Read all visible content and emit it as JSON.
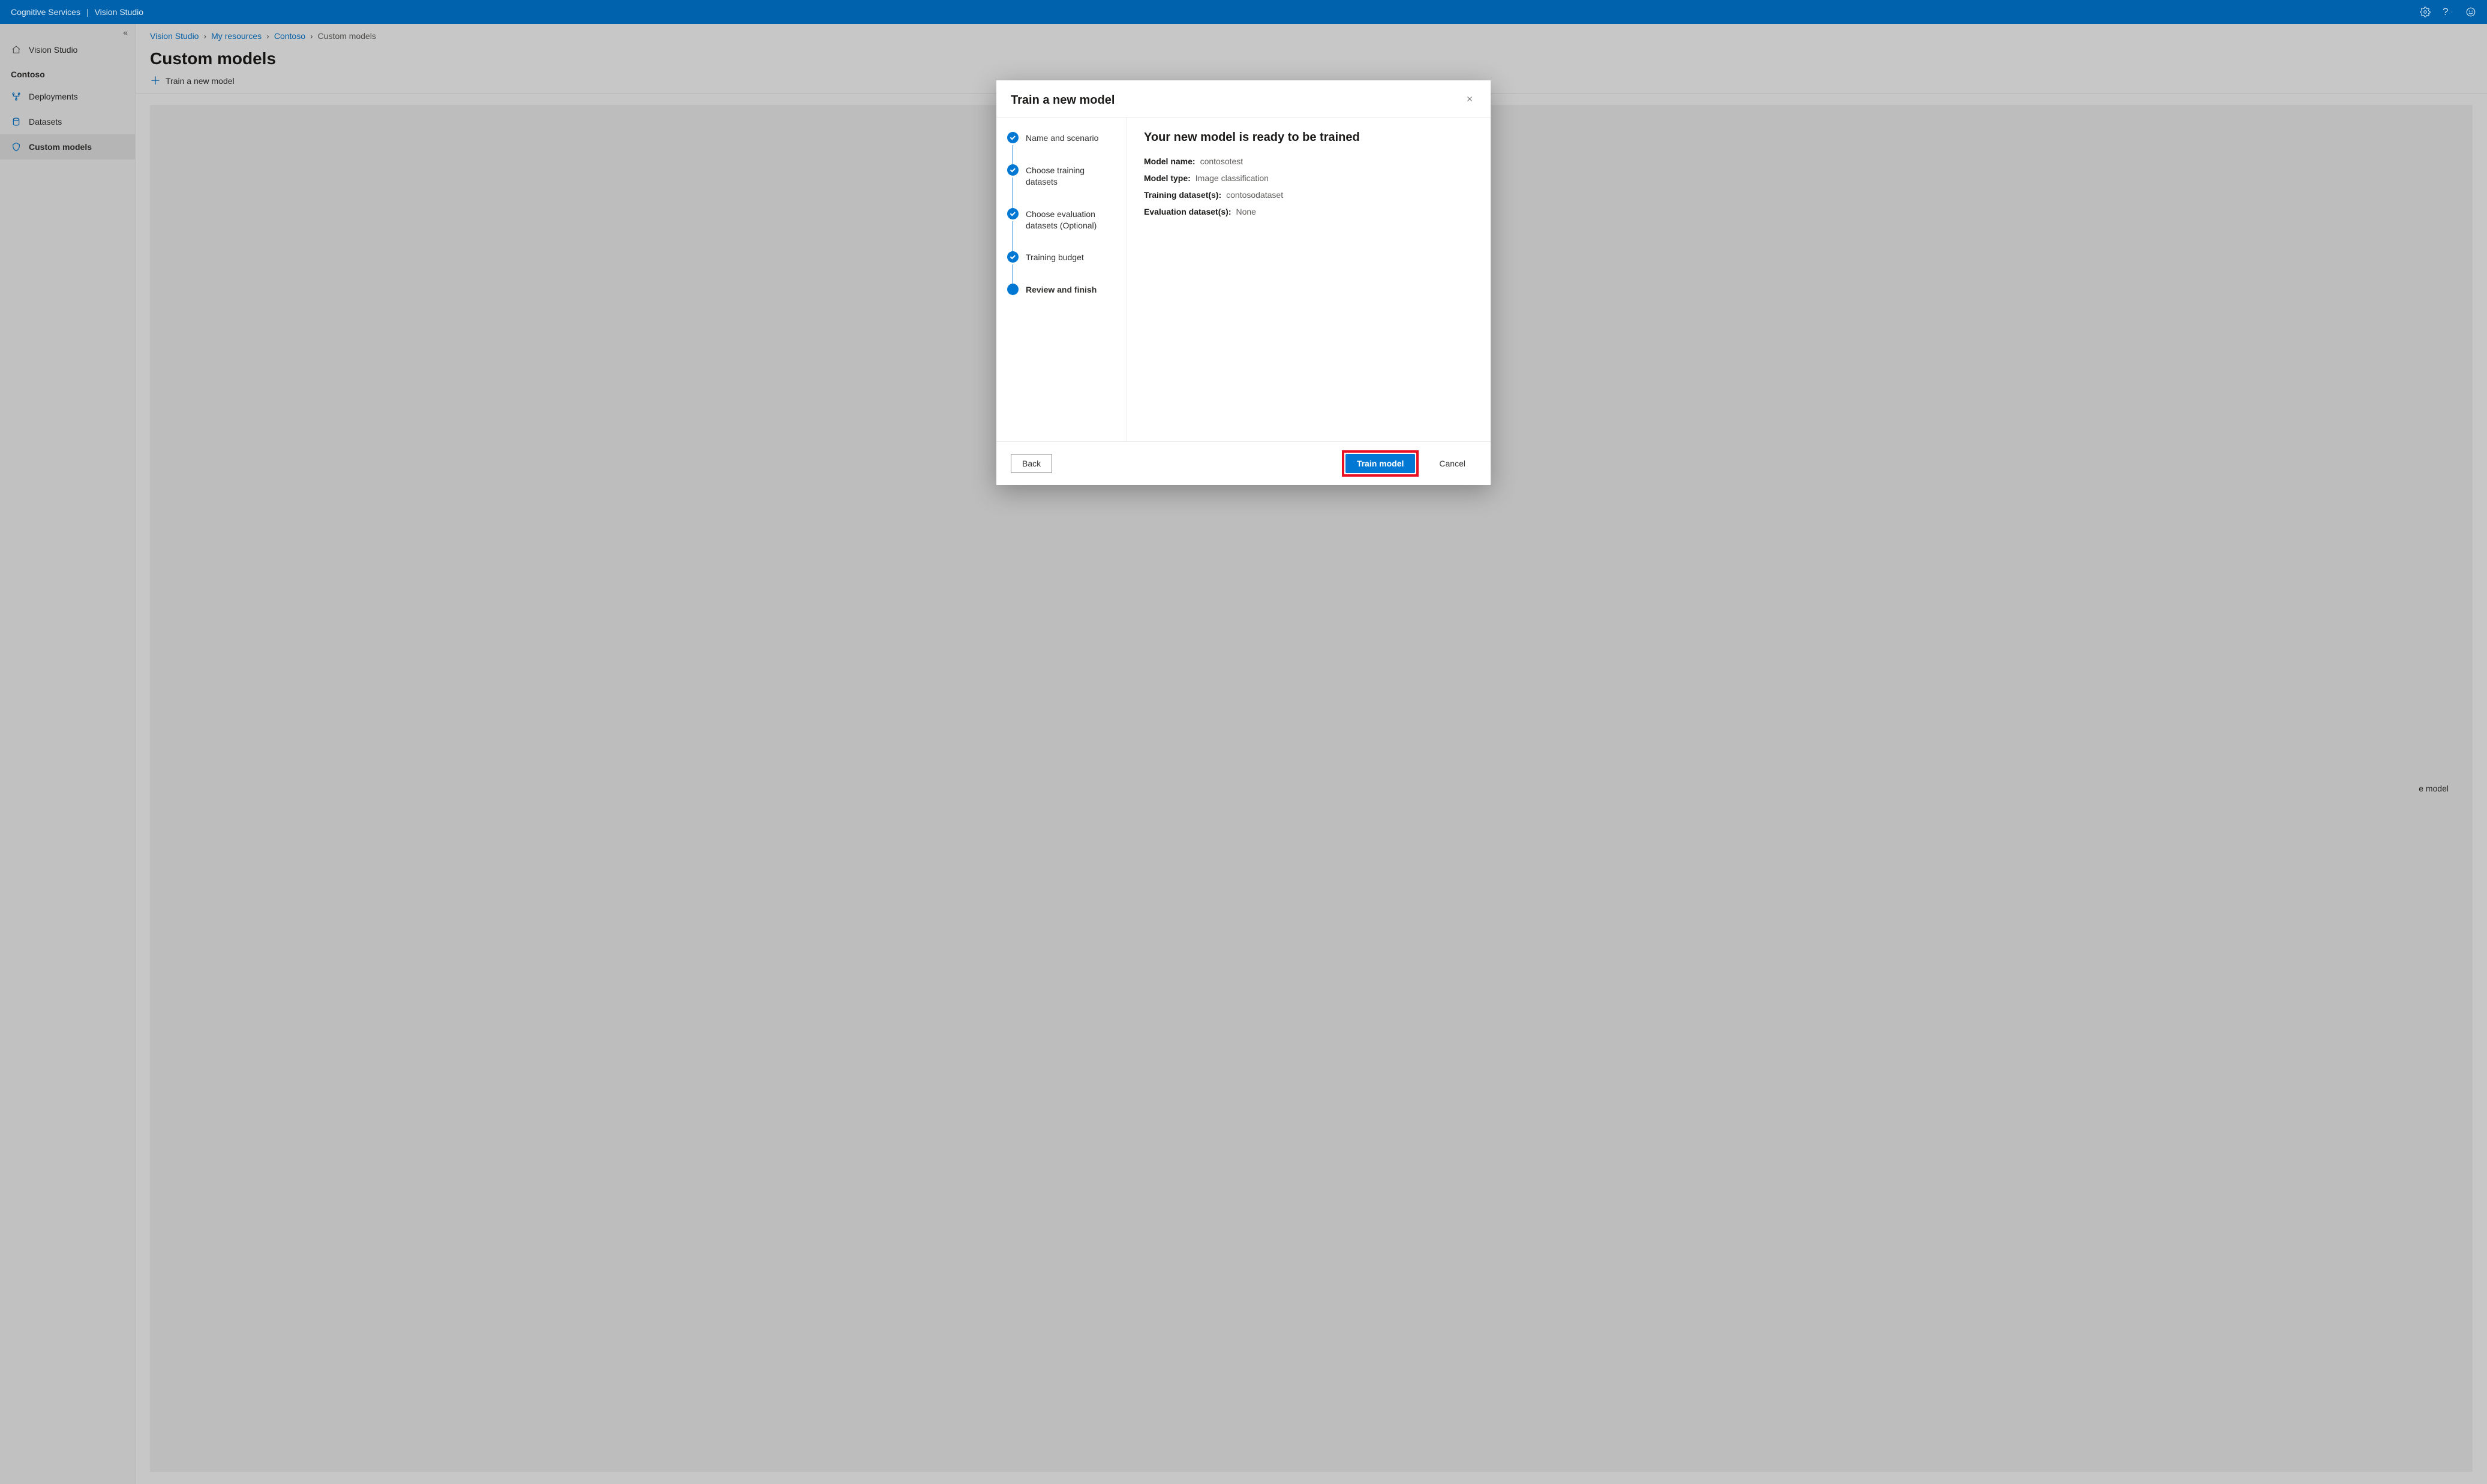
{
  "topbar": {
    "brand": "Cognitive Services",
    "product": "Vision Studio"
  },
  "sidebar": {
    "collapse_icon": "«",
    "home": "Vision Studio",
    "resource_heading": "Contoso",
    "items": [
      {
        "label": "Deployments"
      },
      {
        "label": "Datasets"
      },
      {
        "label": "Custom models"
      }
    ]
  },
  "breadcrumb": {
    "items": [
      "Vision Studio",
      "My resources",
      "Contoso"
    ],
    "current": "Custom models"
  },
  "page": {
    "title": "Custom models",
    "toolbar_train": "Train a new model"
  },
  "canvas": {
    "hint_fragment": "e model"
  },
  "modal": {
    "title": "Train a new model",
    "steps": [
      "Name and scenario",
      "Choose training datasets",
      "Choose evaluation datasets (Optional)",
      "Training budget",
      "Review and finish"
    ],
    "review": {
      "heading": "Your new model is ready to be trained",
      "rows": [
        {
          "k": "Model name:",
          "v": "contosotest"
        },
        {
          "k": "Model type:",
          "v": "Image classification"
        },
        {
          "k": "Training dataset(s):",
          "v": "contosodataset"
        },
        {
          "k": "Evaluation dataset(s):",
          "v": "None"
        }
      ]
    },
    "buttons": {
      "back": "Back",
      "train": "Train model",
      "cancel": "Cancel"
    }
  }
}
